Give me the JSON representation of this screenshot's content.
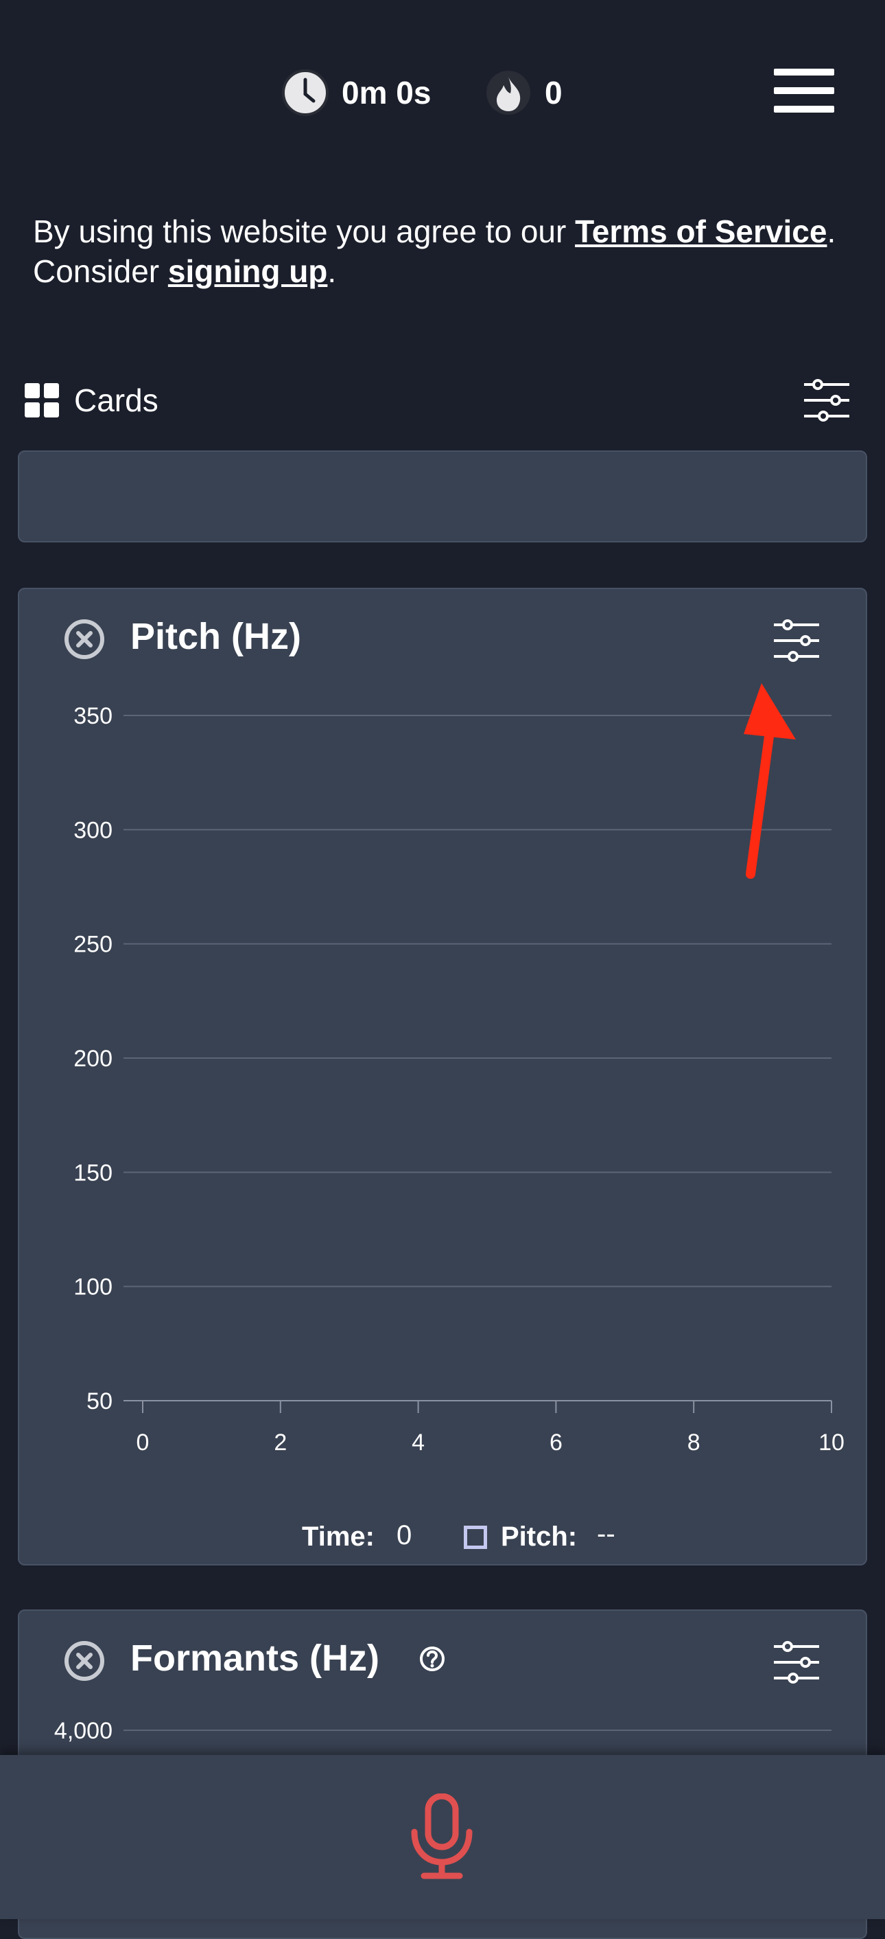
{
  "header": {
    "logo_icon": "waveform-logo-icon",
    "time_value": "0m 0s",
    "time_icon": "clock-icon",
    "streak_value": "0",
    "streak_icon": "flame-icon",
    "menu_icon": "hamburger-menu-icon"
  },
  "notice": {
    "prefix": "By using this website you agree to our ",
    "terms_link": "Terms of Service",
    "middle": ". Consider ",
    "signup_link": "signing up",
    "suffix": "."
  },
  "cards_section": {
    "label": "Cards",
    "icon": "grid-icon",
    "settings_icon": "sliders-icon"
  },
  "pitch_card": {
    "title": "Pitch (Hz)",
    "close_icon": "close-circle-icon",
    "settings_icon": "sliders-icon",
    "legend": {
      "time_label": "Time:",
      "time_value": "0",
      "pitch_label": "Pitch:",
      "pitch_value": "--"
    }
  },
  "formants_card": {
    "title": "Formants (Hz)",
    "help_icon": "question-circle-icon",
    "close_icon": "close-circle-icon",
    "settings_icon": "sliders-icon",
    "first_tick": "4,000"
  },
  "annotation": {
    "color": "#ff2a12",
    "icon": "red-arrow-annotation"
  },
  "bottom_bar": {
    "mic_icon": "microphone-icon",
    "mic_color": "#e05050"
  },
  "chart_data": {
    "type": "line",
    "title": "Pitch (Hz)",
    "xlabel": "",
    "ylabel": "",
    "x_ticks": [
      "0",
      "2",
      "4",
      "6",
      "8",
      "10"
    ],
    "y_ticks": [
      "350",
      "300",
      "250",
      "200",
      "150",
      "100",
      "50"
    ],
    "xlim": [
      0,
      10
    ],
    "ylim": [
      50,
      350
    ],
    "grid": true,
    "series": []
  }
}
